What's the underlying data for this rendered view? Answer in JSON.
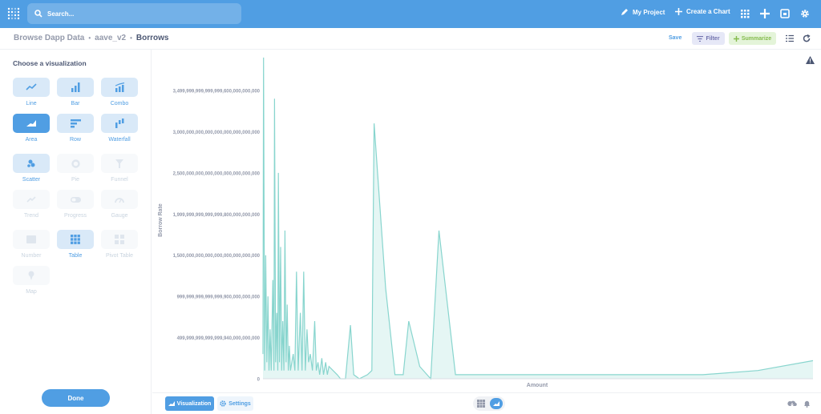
{
  "topbar": {
    "search_placeholder": "Search...",
    "my_project": "My Project",
    "create_chart": "Create a Chart"
  },
  "breadcrumb": {
    "items": [
      "Browse Dapp Data",
      "aave_v2",
      "Borrows"
    ]
  },
  "actions": {
    "save": "Save",
    "filter": "Filter",
    "summarize": "Summarize"
  },
  "sidebar": {
    "title": "Choose a visualization",
    "items": [
      {
        "label": "Line"
      },
      {
        "label": "Bar"
      },
      {
        "label": "Combo"
      },
      {
        "label": "Area"
      },
      {
        "label": "Row"
      },
      {
        "label": "Waterfall"
      },
      {
        "label": "Scatter"
      },
      {
        "label": "Pie"
      },
      {
        "label": "Funnel"
      },
      {
        "label": "Trend"
      },
      {
        "label": "Progress"
      },
      {
        "label": "Gauge"
      },
      {
        "label": "Number"
      },
      {
        "label": "Table"
      },
      {
        "label": "Pivot Table"
      },
      {
        "label": "Map"
      }
    ],
    "done": "Done"
  },
  "bottom": {
    "visualization": "Visualization",
    "settings": "Settings"
  },
  "chart_data": {
    "type": "area",
    "xlabel": "Amount",
    "ylabel": "Borrow Rate",
    "yticks": [
      "3,499,999,999,999,999,600,000,000,000",
      "3,000,000,000,000,000,000,000,000,000",
      "2,500,000,000,000,000,000,000,000,000",
      "1,999,999,999,999,999,800,000,000,000",
      "1,500,000,000,000,000,000,000,000,000",
      "999,999,999,999,999,900,000,000,000",
      "499,999,999,999,999,940,000,000,000",
      "0"
    ],
    "ylim": [
      0,
      3.5e+27
    ],
    "xlim": [
      0,
      100
    ],
    "color": "#88d5ce",
    "points": [
      [
        0,
        0.3
      ],
      [
        0.1,
        3.9
      ],
      [
        0.3,
        0.1
      ],
      [
        0.5,
        1.5
      ],
      [
        0.7,
        0.2
      ],
      [
        0.9,
        1.0
      ],
      [
        1.1,
        0.1
      ],
      [
        1.3,
        0.6
      ],
      [
        1.5,
        0.1
      ],
      [
        1.8,
        1.2
      ],
      [
        2.0,
        0.1
      ],
      [
        2.1,
        3.4
      ],
      [
        2.3,
        0.2
      ],
      [
        2.5,
        0.8
      ],
      [
        2.7,
        0.1
      ],
      [
        2.8,
        2.5
      ],
      [
        3.0,
        0.2
      ],
      [
        3.2,
        1.6
      ],
      [
        3.4,
        0.1
      ],
      [
        3.6,
        0.7
      ],
      [
        3.8,
        0.1
      ],
      [
        4.0,
        1.8
      ],
      [
        4.2,
        0.2
      ],
      [
        4.4,
        0.9
      ],
      [
        4.6,
        0.1
      ],
      [
        4.8,
        0.4
      ],
      [
        5.0,
        0.1
      ],
      [
        5.5,
        0.3
      ],
      [
        5.8,
        0.1
      ],
      [
        6.1,
        1.3
      ],
      [
        6.4,
        0.1
      ],
      [
        6.8,
        0.8
      ],
      [
        7.1,
        0.1
      ],
      [
        7.4,
        1.3
      ],
      [
        7.7,
        0.1
      ],
      [
        8.0,
        0.6
      ],
      [
        8.3,
        0.2
      ],
      [
        8.6,
        0.3
      ],
      [
        9.0,
        0.1
      ],
      [
        9.4,
        0.7
      ],
      [
        9.7,
        0.1
      ],
      [
        10.0,
        0.2
      ],
      [
        10.3,
        0.05
      ],
      [
        10.7,
        0.25
      ],
      [
        11.0,
        0.05
      ],
      [
        11.4,
        0.2
      ],
      [
        11.7,
        0.05
      ],
      [
        12.0,
        0.15
      ],
      [
        13.5,
        0.05
      ],
      [
        14.1,
        0.0
      ],
      [
        15.0,
        0.0
      ],
      [
        15.9,
        0.65
      ],
      [
        16.5,
        0.05
      ],
      [
        17.5,
        0.0
      ],
      [
        19.0,
        0.05
      ],
      [
        19.8,
        0.1
      ],
      [
        20.2,
        3.1
      ],
      [
        22.3,
        1.1
      ],
      [
        24.0,
        0.05
      ],
      [
        25.5,
        0.05
      ],
      [
        26.5,
        0.7
      ],
      [
        28.5,
        0.15
      ],
      [
        30.5,
        0.0
      ],
      [
        32.0,
        1.8
      ],
      [
        35.0,
        0.05
      ],
      [
        40.0,
        0.05
      ],
      [
        45.0,
        0.05
      ],
      [
        60.0,
        0.05
      ],
      [
        80.0,
        0.05
      ],
      [
        90.0,
        0.1
      ],
      [
        100.0,
        0.22
      ]
    ]
  }
}
